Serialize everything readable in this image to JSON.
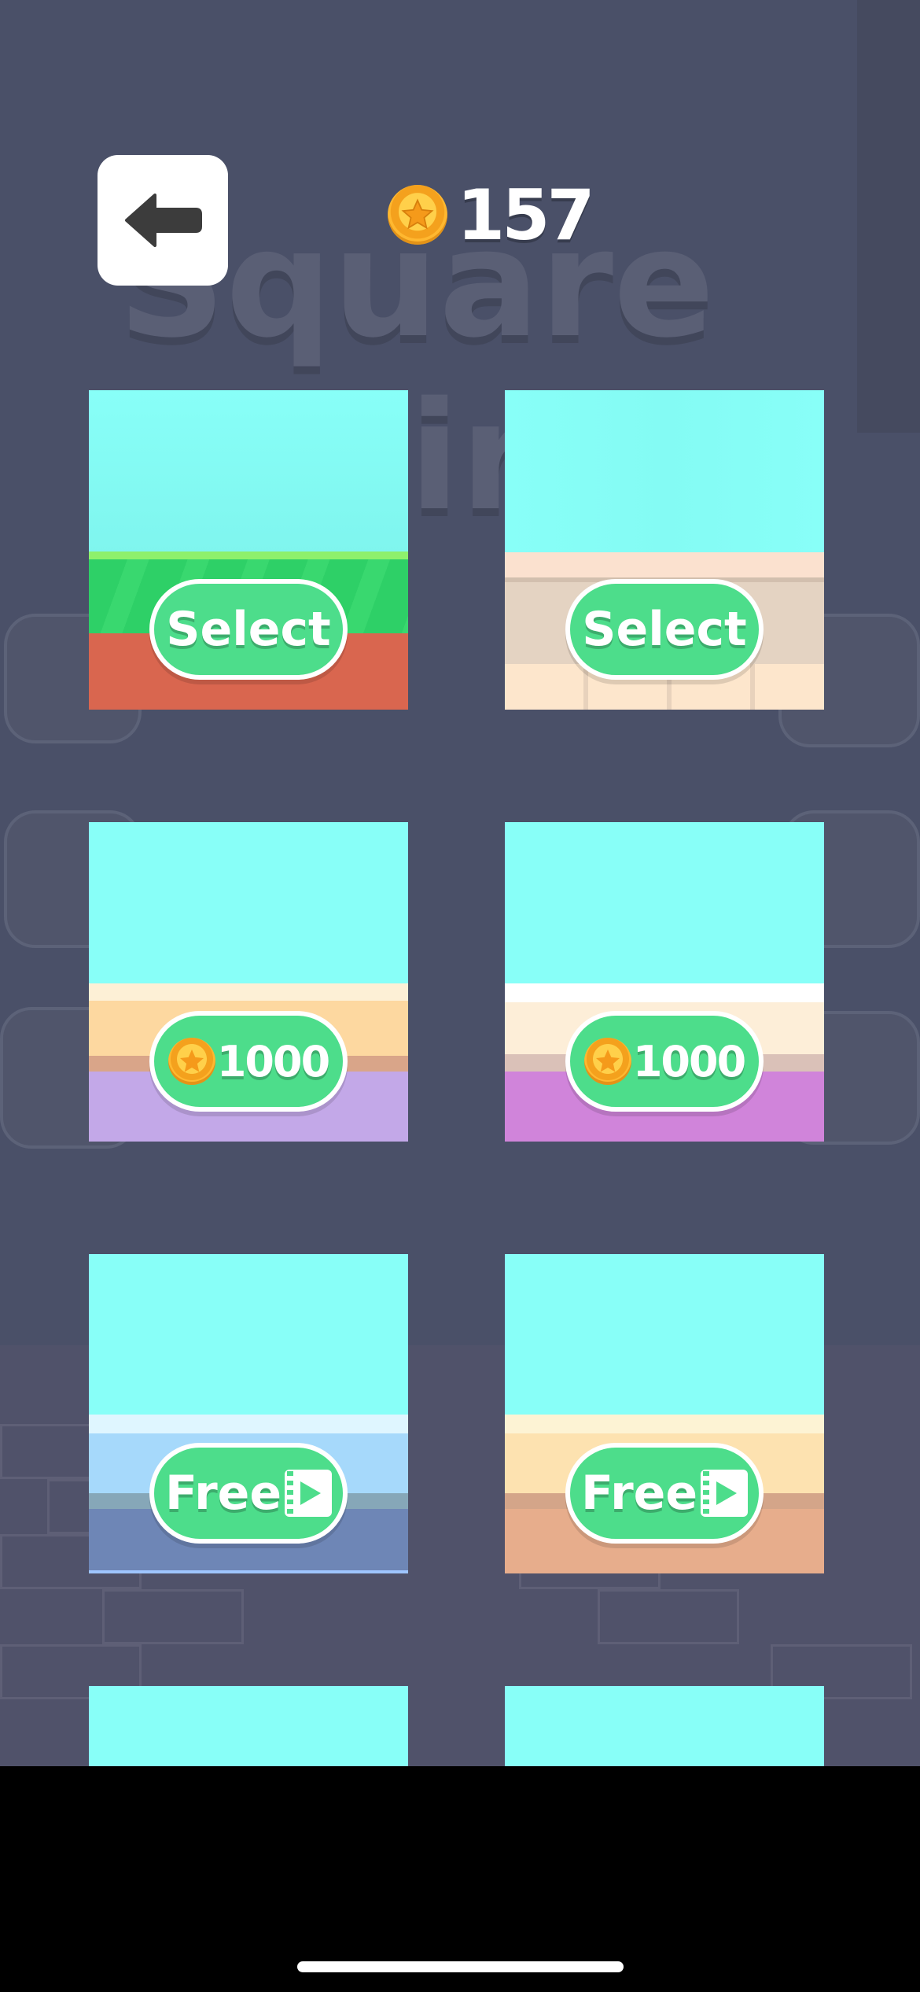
{
  "header": {
    "back_icon": "arrow-left-icon",
    "coin_icon": "star-coin-icon",
    "coins": "157"
  },
  "background_title": [
    "Square",
    "ir"
  ],
  "themes": [
    {
      "id": "grass",
      "action": "Select",
      "colors": {
        "sky": "#88fff8",
        "top": "#2ed067",
        "ground": "#d9664f"
      }
    },
    {
      "id": "sandstone",
      "action": "Select",
      "colors": {
        "sky": "#88fff8",
        "top": "#fbe1cf",
        "ground": "#fde6cc"
      }
    },
    {
      "id": "lavender",
      "action": "1000",
      "colors": {
        "sky": "#88fff8",
        "top": "#fde2b3",
        "ground": "#c3a8e8"
      }
    },
    {
      "id": "magenta",
      "action": "1000",
      "colors": {
        "sky": "#88fff8",
        "top": "#fdf0dd",
        "ground": "#d084da"
      }
    },
    {
      "id": "ice",
      "action": "Free",
      "colors": {
        "sky": "#88fff8",
        "top": "#a6d9fb",
        "ground": "#6e86b6"
      }
    },
    {
      "id": "desert",
      "action": "Free",
      "colors": {
        "sky": "#88fff8",
        "top": "#fde2b0",
        "ground": "#e7ad8c"
      }
    },
    {
      "id": "locked-7"
    },
    {
      "id": "locked-8"
    }
  ]
}
